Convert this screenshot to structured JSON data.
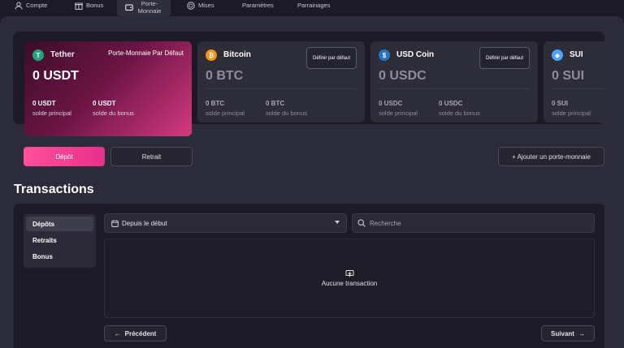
{
  "nav": {
    "items": [
      {
        "label": "Compte",
        "icon": "user-icon"
      },
      {
        "label": "Bonus",
        "icon": "gift-icon"
      },
      {
        "label": "Porte-Monnaie",
        "icon": "wallet-icon",
        "active": true
      },
      {
        "label": "Mises",
        "icon": "chip-icon"
      },
      {
        "label": "Paramètres",
        "icon": ""
      },
      {
        "label": "Parrainages",
        "icon": ""
      }
    ]
  },
  "wallets": [
    {
      "name": "Tether",
      "symbol": "USDT",
      "amount": "0 USDT",
      "default_tag": "Porte-Monnaie Par Défaut",
      "main_value": "0 USDT",
      "main_label": "solde principal",
      "bonus_value": "0 USDT",
      "bonus_label": "solde du bonus",
      "icon": "tether-icon",
      "color": "#26a17b"
    },
    {
      "name": "Bitcoin",
      "symbol": "BTC",
      "amount": "0 BTC",
      "set_default": "Définir par défaut",
      "main_value": "0 BTC",
      "main_label": "solde principal",
      "bonus_value": "0 BTC",
      "bonus_label": "solde du bonus",
      "icon": "bitcoin-icon",
      "color": "#f7931a"
    },
    {
      "name": "USD Coin",
      "symbol": "USDC",
      "amount": "0 USDC",
      "set_default": "Définir par défaut",
      "main_value": "0 USDC",
      "main_label": "solde principal",
      "bonus_value": "0 USDC",
      "bonus_label": "solde du bonus",
      "icon": "usdc-icon",
      "color": "#2775ca"
    },
    {
      "name": "SUI",
      "symbol": "SUI",
      "amount": "0 SUI",
      "main_value": "0 SUI",
      "main_label": "solde principal",
      "icon": "sui-icon",
      "color": "#4da2ff"
    }
  ],
  "actions": {
    "deposit": "Dépôt",
    "withdraw": "Retrait",
    "add_wallet": "+ Ajouter un porte-monnaie"
  },
  "transactions": {
    "title": "Transactions",
    "tabs": [
      "Dépôts",
      "Retraits",
      "Bonus"
    ],
    "date_filter": "Depuis le début",
    "search_placeholder": "Recherche",
    "empty_text": "Aucune transaction",
    "prev": "Précédent",
    "next": "Suivant"
  }
}
